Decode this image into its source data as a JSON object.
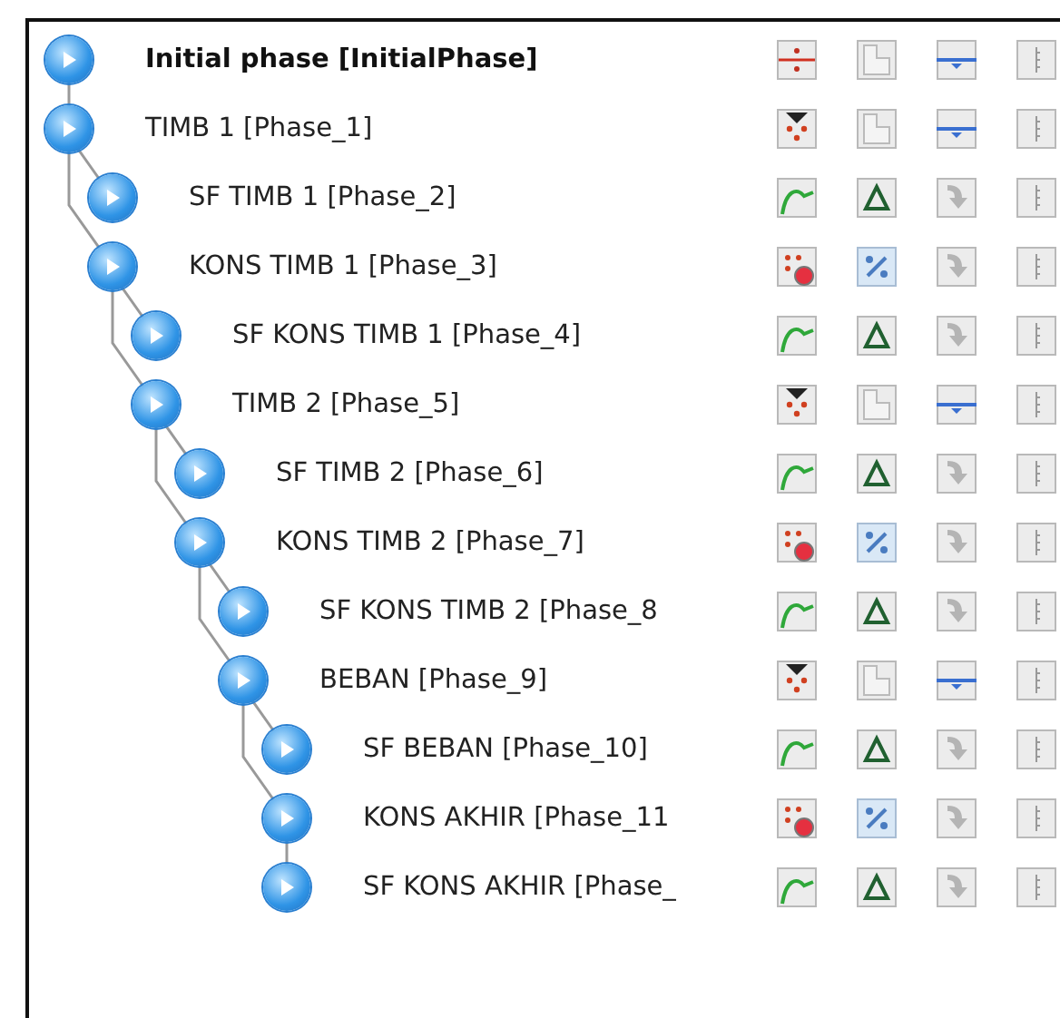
{
  "phases": [
    {
      "name": "Initial phase [InitialPhase]",
      "kind": "initial",
      "selected": true,
      "children": [
        {
          "name": "TIMB 1 [Phase_1]",
          "kind": "construction",
          "selected": false,
          "children": [
            {
              "name": "SF TIMB 1 [Phase_2]",
              "kind": "safety",
              "selected": false
            },
            {
              "name": "KONS TIMB 1 [Phase_3]",
              "kind": "consolidation",
              "selected": false,
              "children": [
                {
                  "name": "SF KONS TIMB 1 [Phase_4]",
                  "kind": "safety",
                  "selected": false
                },
                {
                  "name": "TIMB 2 [Phase_5]",
                  "kind": "construction",
                  "selected": false,
                  "children": [
                    {
                      "name": "SF TIMB 2 [Phase_6]",
                      "kind": "safety",
                      "selected": false
                    },
                    {
                      "name": "KONS TIMB 2 [Phase_7]",
                      "kind": "consolidation",
                      "selected": false,
                      "children": [
                        {
                          "name": "SF KONS TIMB 2 [Phase_8",
                          "kind": "safety",
                          "selected": false
                        },
                        {
                          "name": "BEBAN [Phase_9]",
                          "kind": "construction",
                          "selected": false,
                          "children": [
                            {
                              "name": "SF BEBAN [Phase_10]",
                              "kind": "safety",
                              "selected": false
                            },
                            {
                              "name": "KONS AKHIR [Phase_11",
                              "kind": "consolidation",
                              "selected": false,
                              "children": [
                                {
                                  "name": "SF KONS AKHIR [Phase_",
                                  "kind": "safety",
                                  "selected": false
                                }
                              ]
                            }
                          ]
                        }
                      ]
                    }
                  ]
                }
              ]
            }
          ]
        }
      ]
    }
  ]
}
